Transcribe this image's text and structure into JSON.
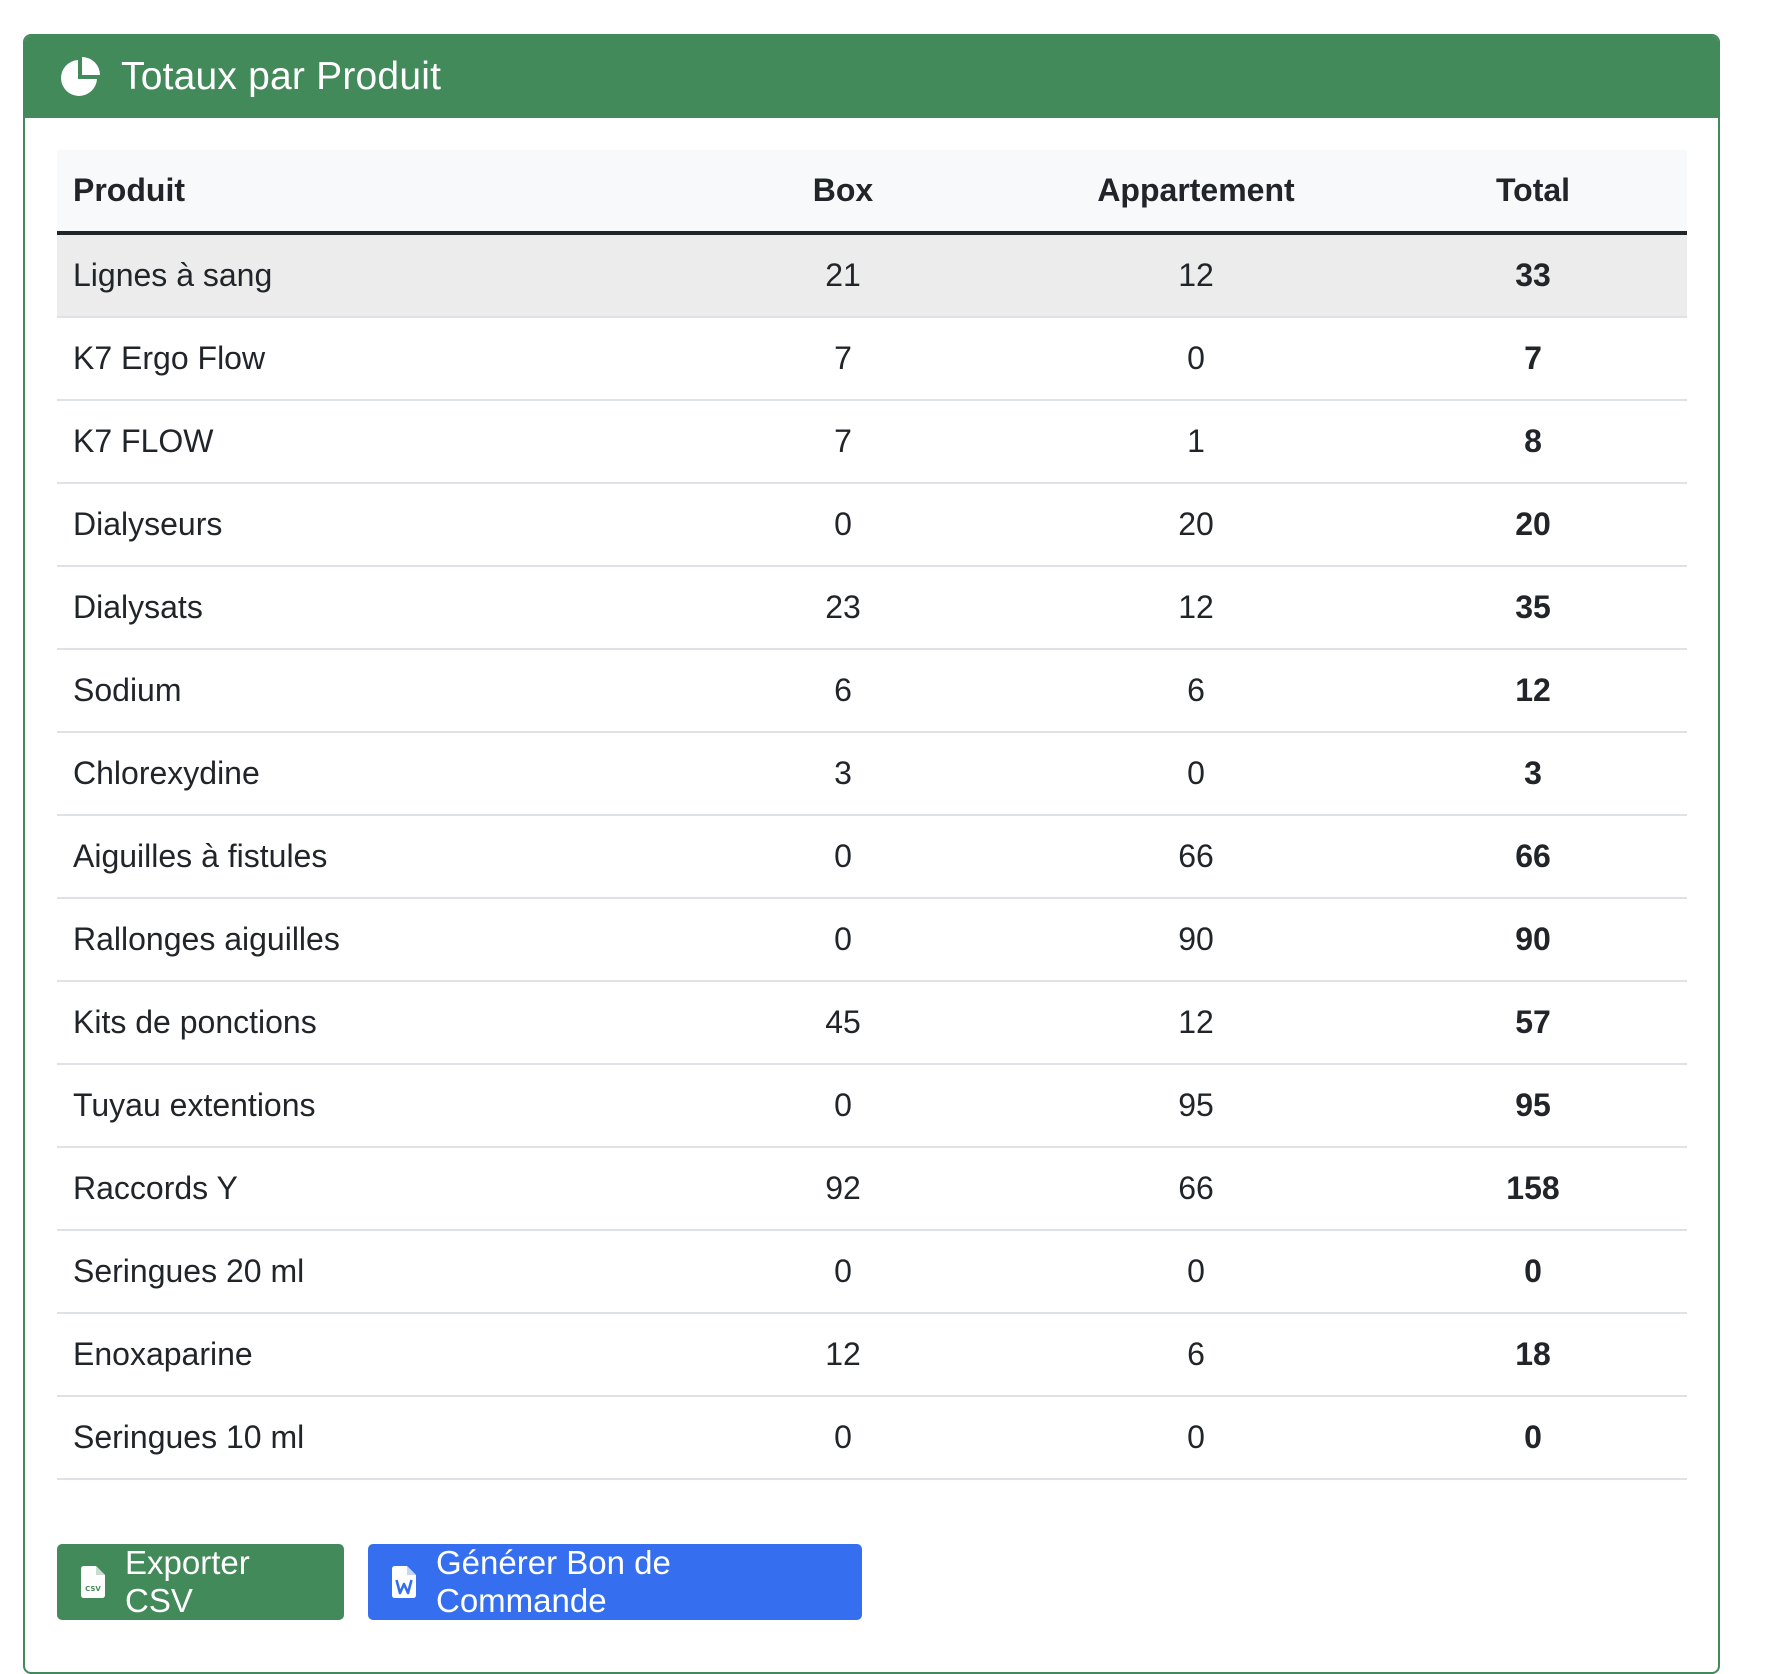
{
  "card": {
    "title": "Totaux par Produit",
    "header_icon": "pie-chart-icon",
    "header_color": "#438a5a"
  },
  "table": {
    "headers": {
      "product": "Produit",
      "box": "Box",
      "apartment": "Appartement",
      "total": "Total"
    },
    "rows": [
      {
        "product": "Lignes à sang",
        "box": "21",
        "apartment": "12",
        "total": "33"
      },
      {
        "product": "K7 Ergo Flow",
        "box": "7",
        "apartment": "0",
        "total": "7"
      },
      {
        "product": "K7 FLOW",
        "box": "7",
        "apartment": "1",
        "total": "8"
      },
      {
        "product": "Dialyseurs",
        "box": "0",
        "apartment": "20",
        "total": "20"
      },
      {
        "product": "Dialysats",
        "box": "23",
        "apartment": "12",
        "total": "35"
      },
      {
        "product": "Sodium",
        "box": "6",
        "apartment": "6",
        "total": "12"
      },
      {
        "product": "Chlorexydine",
        "box": "3",
        "apartment": "0",
        "total": "3"
      },
      {
        "product": "Aiguilles à fistules",
        "box": "0",
        "apartment": "66",
        "total": "66"
      },
      {
        "product": "Rallonges aiguilles",
        "box": "0",
        "apartment": "90",
        "total": "90"
      },
      {
        "product": "Kits de ponctions",
        "box": "45",
        "apartment": "12",
        "total": "57"
      },
      {
        "product": "Tuyau extentions",
        "box": "0",
        "apartment": "95",
        "total": "95"
      },
      {
        "product": "Raccords Y",
        "box": "92",
        "apartment": "66",
        "total": "158"
      },
      {
        "product": "Seringues 20 ml",
        "box": "0",
        "apartment": "0",
        "total": "0"
      },
      {
        "product": "Enoxaparine",
        "box": "12",
        "apartment": "6",
        "total": "18"
      },
      {
        "product": "Seringues 10 ml",
        "box": "0",
        "apartment": "0",
        "total": "0"
      }
    ]
  },
  "actions": {
    "export_csv": {
      "label": "Exporter CSV",
      "icon": "csv-file-icon",
      "color": "#438a5a"
    },
    "generate_order": {
      "label": "Générer Bon de Commande",
      "icon": "word-file-icon",
      "color": "#356ff0"
    }
  }
}
